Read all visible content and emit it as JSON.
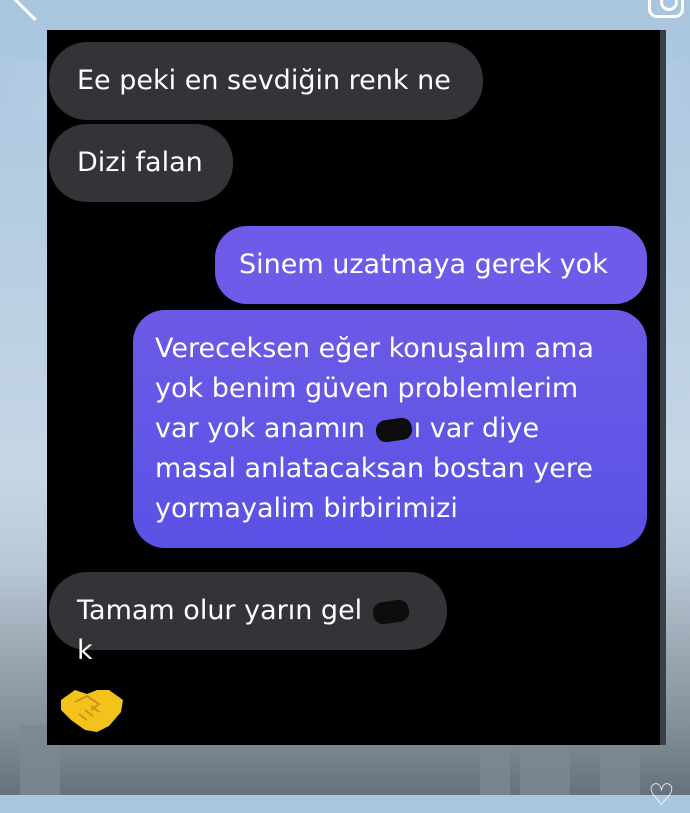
{
  "messages": [
    {
      "side": "in",
      "text": "Ee peki en sevdiğin renk ne"
    },
    {
      "side": "in",
      "text": "Dizi falan"
    },
    {
      "side": "out",
      "text": "Sinem uzatmaya gerek yok"
    },
    {
      "side": "out",
      "lines": [
        "Vereceksen eğer konuşalım ama",
        "yok benim güven problemlerim",
        "var yok anamın ",
        "ı var diye",
        "masal anlatacaksan bostan yere",
        "yormayalim birbirimizi"
      ]
    },
    {
      "side": "in",
      "text_before": "Tamam olur yarın gel ",
      "text_after": "k"
    }
  ],
  "reaction": {
    "icon": "handshake-icon",
    "color": "#f3c21b"
  },
  "colors": {
    "incoming": "#333338",
    "outgoing": "#6f5bea",
    "screen": "#000000"
  },
  "icons": [
    "back-chevron-icon",
    "instagram-icon",
    "heart-icon",
    "redaction-scribble-icon"
  ]
}
